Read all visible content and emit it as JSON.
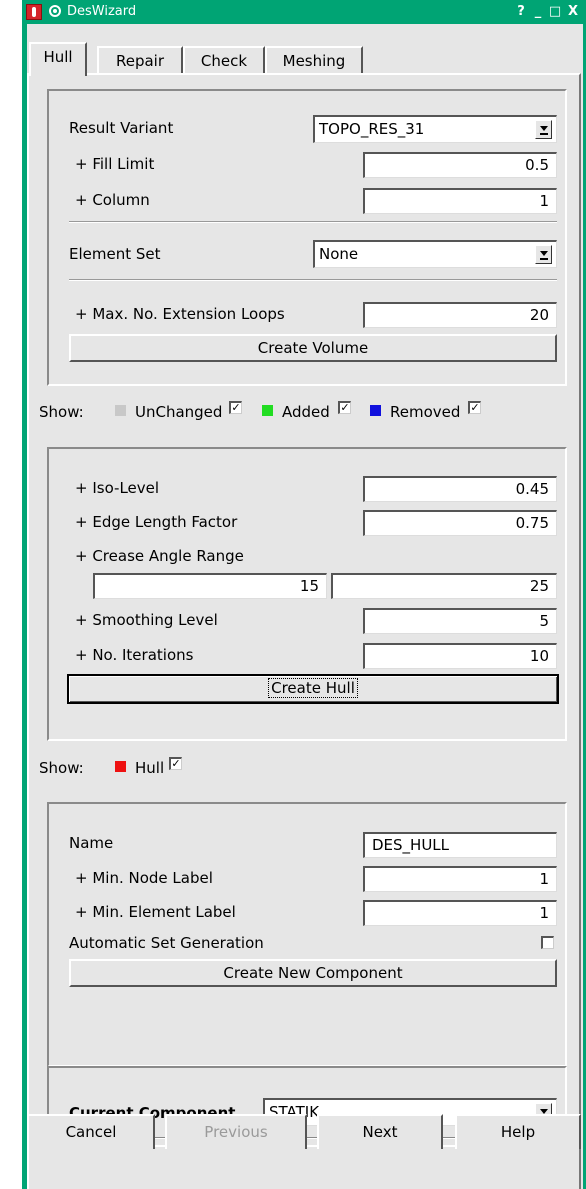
{
  "window": {
    "title": "DesWizard",
    "title_buttons": [
      "?",
      "_",
      "□",
      "X"
    ]
  },
  "tabs": [
    "Hull",
    "Repair",
    "Check",
    "Meshing"
  ],
  "volume": {
    "result_variant_label": "Result Variant",
    "result_variant_value": "TOPO_RES_31",
    "fill_limit_label": "+ Fill Limit",
    "fill_limit_value": "0.5",
    "column_label": "+ Column",
    "column_value": "1",
    "element_set_label": "Element Set",
    "element_set_value": "None",
    "max_loops_label": "+ Max. No. Extension Loops",
    "max_loops_value": "20",
    "create_volume_button": "Create Volume"
  },
  "show_volume": {
    "label": "Show:",
    "items": [
      {
        "label": "UnChanged",
        "color": "#c8c8c8",
        "checked": true
      },
      {
        "label": "Added",
        "color": "#22dd22",
        "checked": true
      },
      {
        "label": "Removed",
        "color": "#1111dd",
        "checked": true
      }
    ]
  },
  "hull": {
    "iso_level_label": "+ Iso-Level",
    "iso_level_value": "0.45",
    "edge_length_label": "+ Edge Length Factor",
    "edge_length_value": "0.75",
    "crease_label": "+ Crease Angle Range",
    "crease_min": "15",
    "crease_max": "25",
    "smoothing_label": "+ Smoothing Level",
    "smoothing_value": "5",
    "iterations_label": "+ No. Iterations",
    "iterations_value": "10",
    "create_hull_button": "Create Hull"
  },
  "show_hull": {
    "label": "Show:",
    "item_label": "Hull",
    "color": "#ee1111",
    "checked": true
  },
  "component": {
    "name_label": "Name",
    "name_value": "DES_HULL",
    "min_node_label": "+ Min. Node Label",
    "min_node_value": "1",
    "min_element_label": "+ Min. Element Label",
    "min_element_value": "1",
    "auto_set_label": "Automatic Set Generation",
    "auto_set_checked": false,
    "create_component_button": "Create New Component"
  },
  "current": {
    "label": "Current Component",
    "value": "STATIK"
  },
  "footer": {
    "cancel": "Cancel",
    "previous": "Previous",
    "next": "Next",
    "help": "Help"
  }
}
